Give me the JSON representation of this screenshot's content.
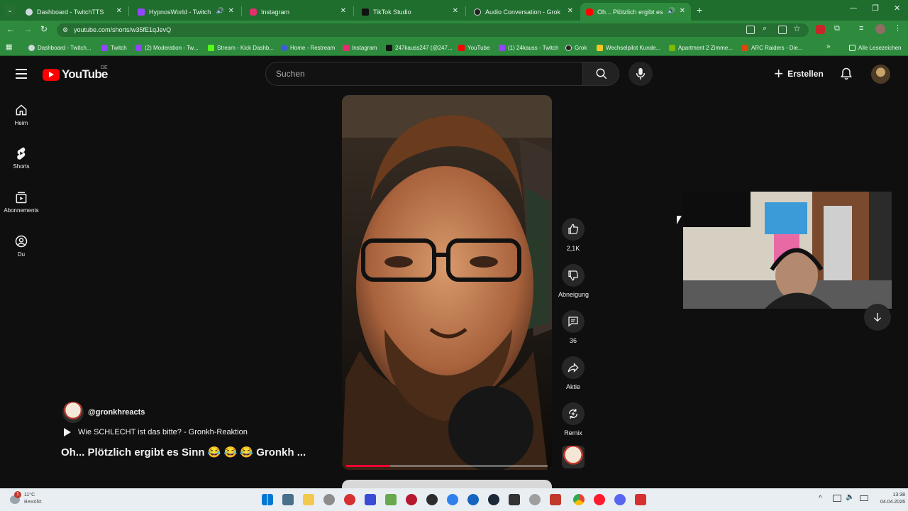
{
  "tabs": [
    {
      "title": "Dashboard - TwitchTTS",
      "color": "#6441a5"
    },
    {
      "title": "HypnosWorld - Twitch",
      "color": "#9146ff"
    },
    {
      "title": "Instagram",
      "color": "#e1306c"
    },
    {
      "title": "TikTok Studio",
      "color": "#111111"
    },
    {
      "title": "Audio Conversation - Grok",
      "color": "#222222"
    },
    {
      "title": "Oh... Plötzlich ergibt es Sinn",
      "color": "#ff0000"
    }
  ],
  "address": {
    "url": "youtube.com/shorts/w35fE1qJevQ"
  },
  "bookmarks": [
    {
      "label": "Dashboard - Twitch...",
      "color": "#6441a5"
    },
    {
      "label": "Twitch",
      "color": "#9146ff"
    },
    {
      "label": "(2) Moderation - Tw...",
      "color": "#9146ff"
    },
    {
      "label": "Stream - Kick Dashb...",
      "color": "#53fc18"
    },
    {
      "label": "Home - Restream",
      "color": "#3b5bdb"
    },
    {
      "label": "Instagram",
      "color": "#e1306c"
    },
    {
      "label": "247kauss247 (@247...",
      "color": "#111111"
    },
    {
      "label": "YouTube",
      "color": "#ff0000"
    },
    {
      "label": "(1) 24kauss - Twitch",
      "color": "#9146ff"
    },
    {
      "label": "Grok",
      "color": "#222222"
    },
    {
      "label": "Wechselpilot Kunde...",
      "color": "#f3c623"
    },
    {
      "label": "Apartment 2 Zimme...",
      "color": "#7fb800"
    },
    {
      "label": "ARC Raiders - Die...",
      "color": "#d9480f"
    }
  ],
  "bookmarks_all": "Alle Lesezeichen",
  "youtube": {
    "logo_text": "YouTube",
    "region": "DE",
    "search_placeholder": "Suchen",
    "create_label": "Erstellen"
  },
  "nav": [
    {
      "label": "Heim",
      "icon": "home-icon"
    },
    {
      "label": "Shorts",
      "icon": "shorts-icon"
    },
    {
      "label": "Abonnements",
      "icon": "subscriptions-icon"
    },
    {
      "label": "Du",
      "icon": "account-icon"
    }
  ],
  "actions": {
    "like_count": "2,1K",
    "dislike_label": "Abneigung",
    "comment_count": "36",
    "share_label": "Aktie",
    "remix_label": "Remix"
  },
  "video": {
    "channel": "@gronkhreacts",
    "reaction_title": "Wie SCHLECHT ist das bitte? - Gronkh-Reaktion",
    "title": "Oh... Plötzlich ergibt es Sinn 😂 😂 😂 Gronkh ...",
    "progress": 0.22
  },
  "taskbar": {
    "weather_temp": "11°C",
    "weather_desc": "Bewölkt",
    "notification_count": "1",
    "time": "13:38",
    "date": "04.04.2026"
  }
}
